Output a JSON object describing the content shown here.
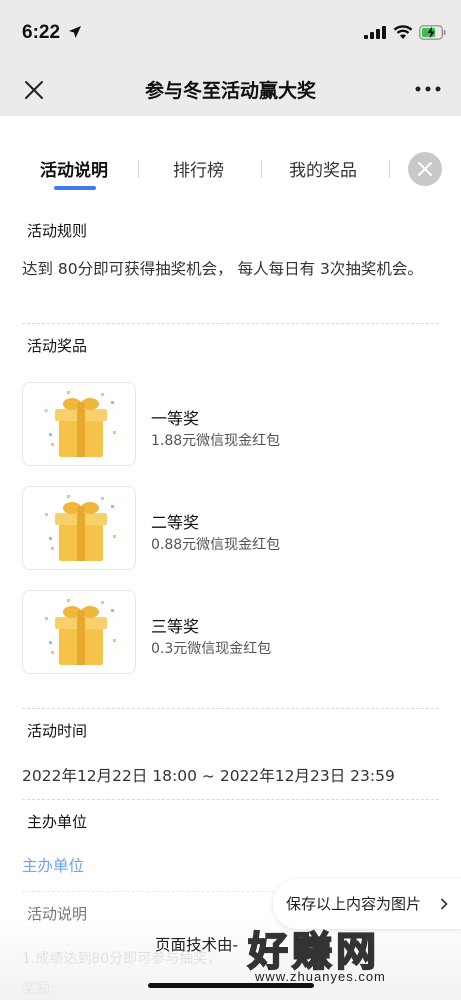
{
  "status": {
    "time": "6:22"
  },
  "nav": {
    "title": "参与冬至活动赢大奖"
  },
  "tabs": [
    {
      "label": "活动说明"
    },
    {
      "label": "排行榜"
    },
    {
      "label": "我的奖品"
    }
  ],
  "rules": {
    "heading": "活动规则",
    "text": "达到 80分即可获得抽奖机会， 每人每日有 3次抽奖机会。"
  },
  "prizes": {
    "heading": "活动奖品",
    "items": [
      {
        "name": "一等奖",
        "desc": "1.88元微信现金红包"
      },
      {
        "name": "二等奖",
        "desc": "0.88元微信现金红包"
      },
      {
        "name": "三等奖",
        "desc": "0.3元微信现金红包"
      }
    ]
  },
  "time": {
    "heading": "活动时间",
    "text": "2022年12月22日 18:00 ~ 2022年12月23日 23:59"
  },
  "organizer": {
    "heading": "主办单位",
    "link": "主办单位"
  },
  "description": {
    "heading": "活动说明",
    "line1": "1.成绩达到80分即可参与抽奖，",
    "line2": "奖励:"
  },
  "save_button": "保存以上内容为图片",
  "tech_text": "页面技术由-",
  "watermark": {
    "text": "好赚网",
    "url": "www.zhuanyes.com"
  },
  "colors": {
    "accent": "#3b7cf2",
    "tag_bg": "#e3ecfd",
    "gift": "#f5c24a"
  }
}
